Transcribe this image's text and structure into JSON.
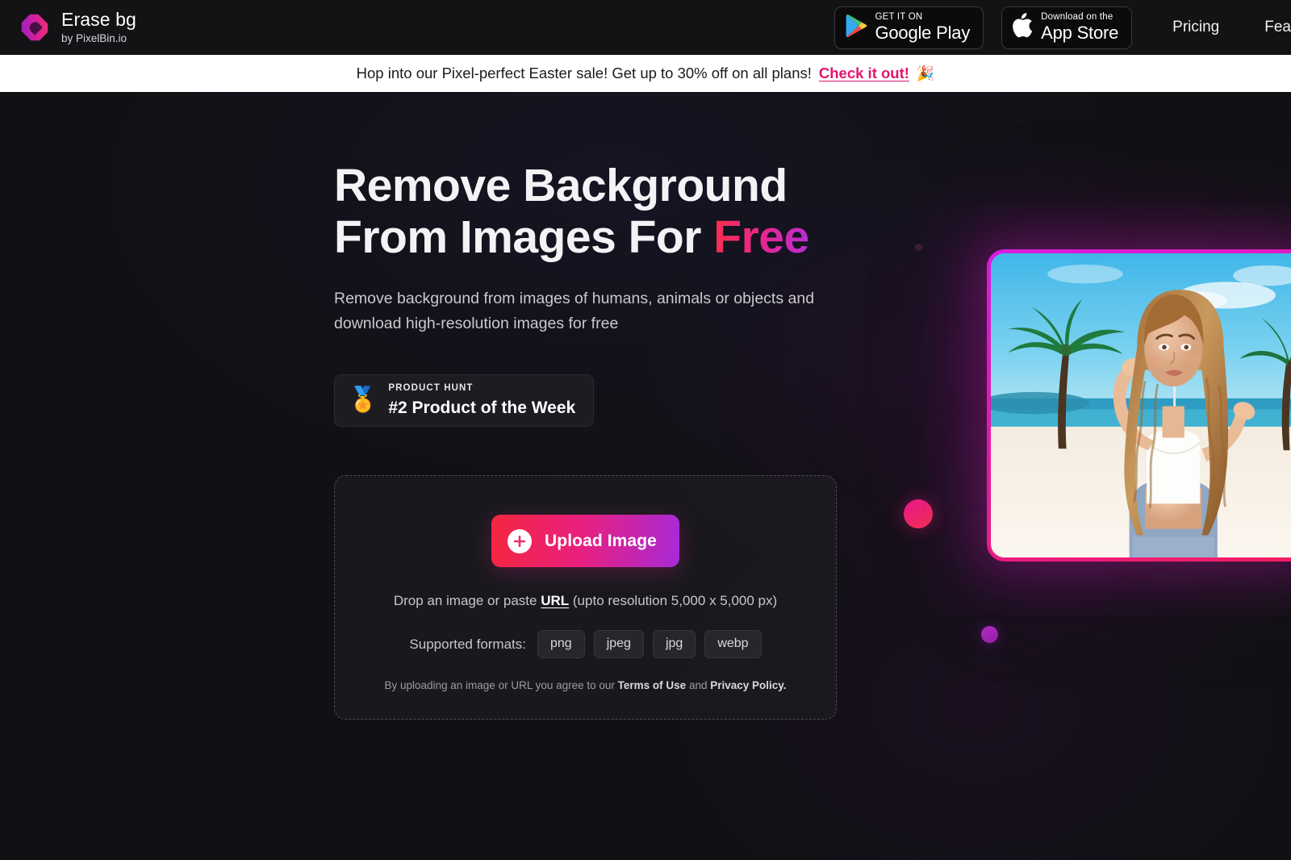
{
  "header": {
    "brand_name": "Erase bg",
    "brand_sub": "by PixelBin.io",
    "logo_icon": "erase-bg-diamond-logo",
    "google_play": {
      "top": "GET IT ON",
      "bottom": "Google Play",
      "icon": "google-play-icon"
    },
    "app_store": {
      "top": "Download on the",
      "bottom": "App Store",
      "icon": "apple-icon"
    },
    "nav": [
      {
        "label": "Pricing"
      },
      {
        "label": "Fea"
      }
    ]
  },
  "announcement": {
    "text": "Hop into our Pixel-perfect Easter sale! Get up to 30% off on all plans!",
    "cta": "Check it out!",
    "emoji": "🎉"
  },
  "hero": {
    "headline_line1": "Remove Background",
    "headline_line2_prefix": "From Images For ",
    "headline_accent": "Free",
    "subhead": "Remove background from images of humans, animals or objects and download high-resolution images for free",
    "product_hunt": {
      "medal": "🏅",
      "kicker": "PRODUCT HUNT",
      "title": "#2 Product of the Week"
    }
  },
  "upload": {
    "button_label": "Upload Image",
    "plus_icon": "plus-icon",
    "drop_prefix": "Drop an image or paste ",
    "drop_url": "URL",
    "drop_suffix": " (upto resolution 5,000 x 5,000 px)",
    "formats_label": "Supported formats:",
    "formats": [
      "png",
      "jpeg",
      "jpg",
      "webp"
    ],
    "terms_prefix": "By uploading an image or URL you agree to our ",
    "terms_of_use": "Terms of Use",
    "terms_and": " and ",
    "privacy_policy": "Privacy Policy."
  },
  "preview": {
    "alt": "woman-with-long-curly-hair-on-beach-with-palm-trees"
  },
  "colors": {
    "accent_pink": "#e8207f",
    "accent_red": "#f5263f",
    "accent_purple": "#a82ad6",
    "announce_cta": "#e0156d",
    "page_bg": "#111115",
    "header_bg": "#131316"
  }
}
